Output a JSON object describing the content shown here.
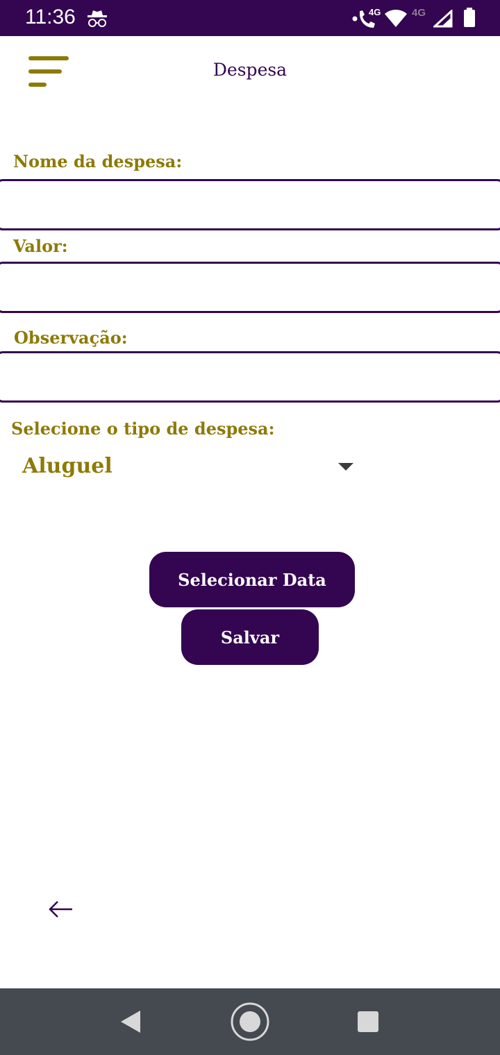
{
  "status_bar": {
    "time": "11:36",
    "net_label_1": "4G",
    "net_label_2": "4G",
    "icons": [
      "incognito-icon",
      "wifi-calling-icon",
      "wifi-icon",
      "cell-signal-icon",
      "battery-icon"
    ]
  },
  "app_bar": {
    "title": "Despesa",
    "menu_icon": "menu-icon"
  },
  "form": {
    "name_label": "Nome da despesa:",
    "name_value": "",
    "value_label": "Valor:",
    "value_value": "",
    "note_label": "Observação:",
    "note_value": "",
    "type_label": "Selecione o tipo de despesa:",
    "type_selected": "Aluguel"
  },
  "actions": {
    "select_date": "Selecionar Data",
    "save": "Salvar"
  },
  "colors": {
    "primary": "#340550",
    "accent": "#8d7a06",
    "nav_bar": "#454a50"
  },
  "nav": {
    "icons": [
      "back-triangle-icon",
      "home-circle-icon",
      "recents-square-icon"
    ]
  }
}
